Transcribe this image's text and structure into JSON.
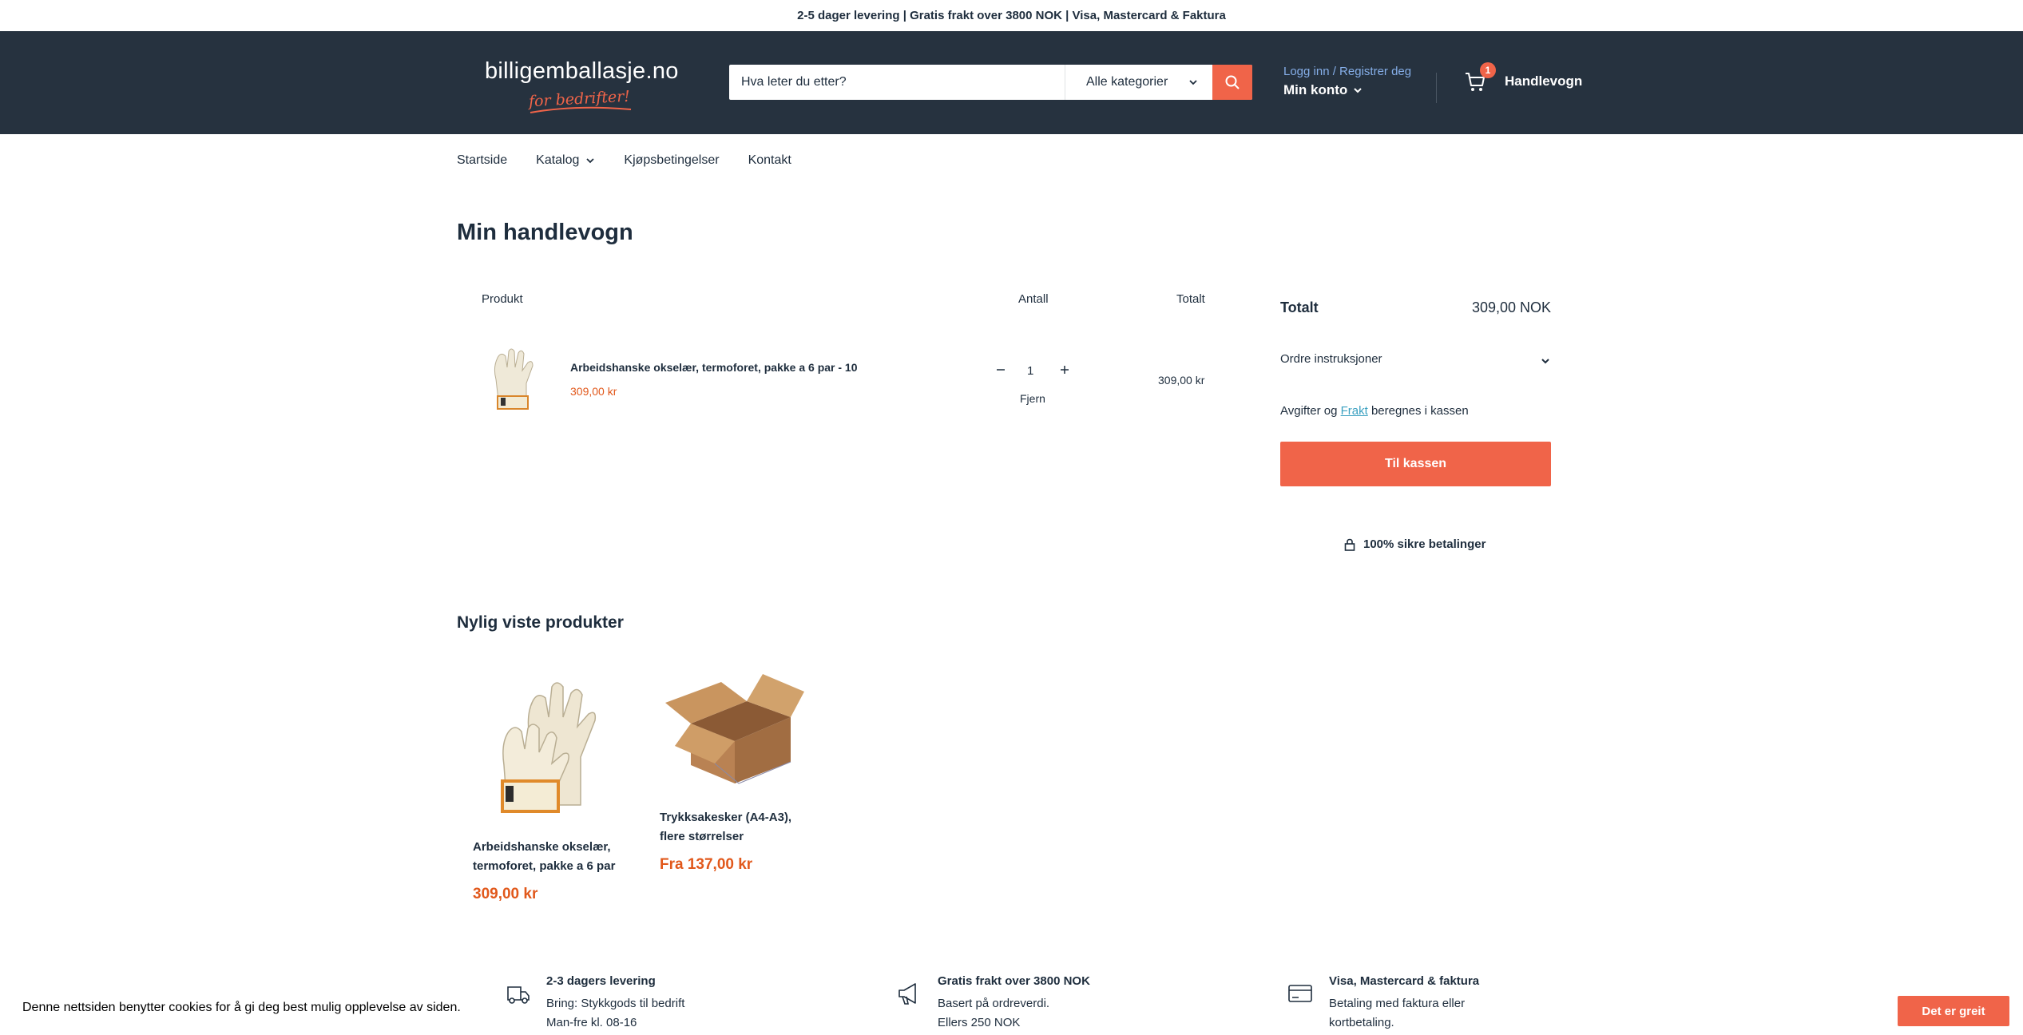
{
  "announcement": "2-5 dager levering | Gratis frakt over 3800 NOK | Visa, Mastercard & Faktura",
  "header": {
    "logo_text": "billigemballasje.no",
    "logo_tagline": "for bedrifter!",
    "search_placeholder": "Hva leter du etter?",
    "category_label": "Alle kategorier",
    "account_login": "Logg inn / Registrer deg",
    "account_label": "Min konto",
    "cart_count": "1",
    "cart_label": "Handlevogn"
  },
  "nav": {
    "items": [
      "Startside",
      "Katalog",
      "Kjøpsbetingelser",
      "Kontakt"
    ]
  },
  "page_title": "Min handlevogn",
  "cart_table": {
    "headers": {
      "product": "Produkt",
      "quantity": "Antall",
      "total": "Totalt"
    },
    "items": [
      {
        "title": "Arbeidshanske okselær, termoforet, pakke a 6 par - 10",
        "price": "309,00 kr",
        "quantity": "1",
        "remove_label": "Fjern",
        "line_total": "309,00 kr"
      }
    ]
  },
  "summary": {
    "total_label": "Totalt",
    "total_value": "309,00 NOK",
    "order_instructions": "Ordre instruksjoner",
    "tax_note_prefix": "Avgifter og",
    "tax_note_link": "Frakt",
    "tax_note_suffix": "beregnes i kassen",
    "checkout_label": "Til kassen",
    "secure_label": "100% sikre betalinger"
  },
  "recent": {
    "title": "Nylig viste produkter",
    "products": [
      {
        "title": "Arbeidshanske okselær, termoforet, pakke a 6 par",
        "price": "309,00 kr"
      },
      {
        "title": "Trykksakesker (A4-A3), flere størrelser",
        "price": "Fra 137,00 kr"
      }
    ]
  },
  "features": [
    {
      "icon": "delivery-truck-icon",
      "title": "2-3 dagers levering",
      "lines": [
        "Bring: Stykkgods til bedrift",
        "Man-fre kl. 08-16"
      ]
    },
    {
      "icon": "megaphone-icon",
      "title": "Gratis frakt over 3800 NOK",
      "lines": [
        "Basert på ordreverdi.",
        "Ellers 250 NOK"
      ]
    },
    {
      "icon": "credit-card-icon",
      "title": "Visa, Mastercard & faktura",
      "lines": [
        "Betaling med faktura eller",
        "kortbetaling."
      ]
    }
  ],
  "cookie": {
    "text": "Denne nettsiden benytter cookies for å gi deg best mulig opplevelse av siden.",
    "button": "Det er greit"
  },
  "colors": {
    "header_bg": "#26323f",
    "accent": "#f06449",
    "price": "#e1581b",
    "link": "#85aee8"
  }
}
